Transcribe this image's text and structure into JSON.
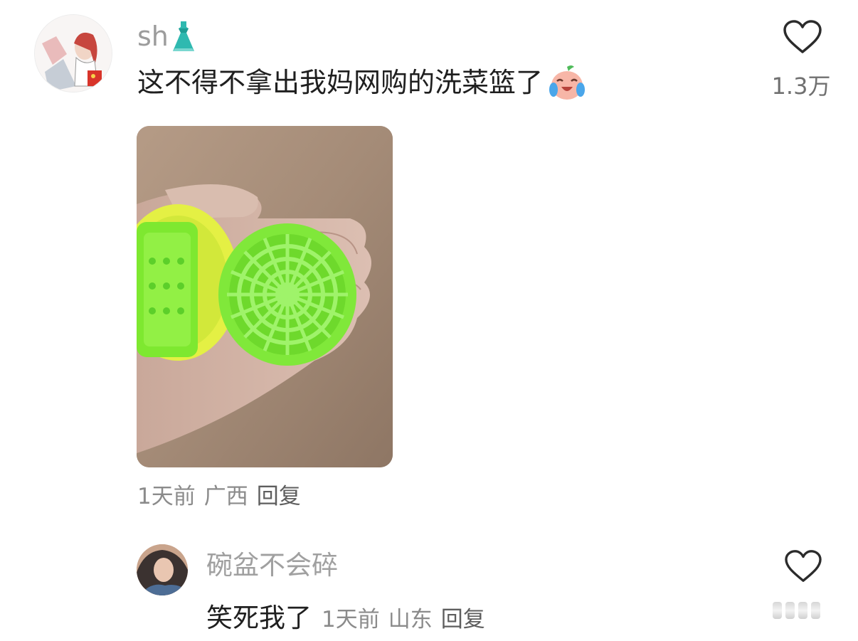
{
  "comment": {
    "username": "sh",
    "username_emoji": "dress-icon",
    "text": "这不得不拿出我妈网购的洗菜篮了",
    "text_emoji": "crying-laughing-emoji",
    "like_count": "1.3万",
    "time": "1天前",
    "location": "广西",
    "reply_label": "回复"
  },
  "reply": {
    "username": "碗盆不会碎",
    "text": "笑死我了",
    "time": "1天前",
    "location": "山东",
    "reply_label": "回复"
  },
  "colors": {
    "basket_green": "#7ee830",
    "basket_yellow": "#e6f53c"
  }
}
